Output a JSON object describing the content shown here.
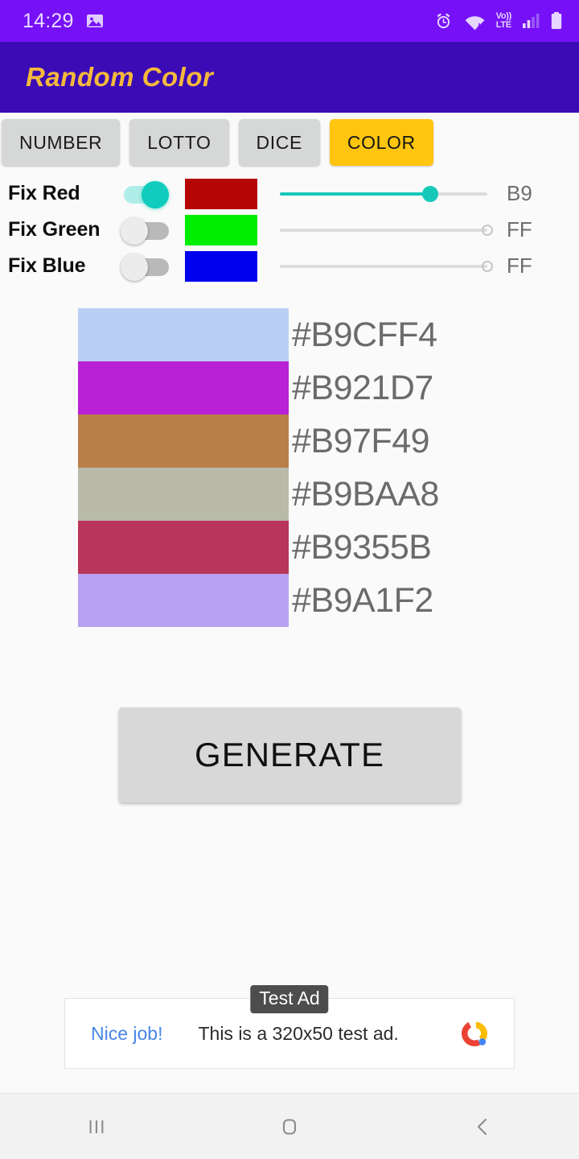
{
  "status_bar": {
    "time": "14:29",
    "icons": [
      "image-icon",
      "alarm-icon",
      "wifi-icon",
      "volte-icon",
      "signal-icon",
      "battery-icon"
    ],
    "volte_top": "Vo))",
    "volte_bottom": "LTE",
    "background": "#7510F7",
    "foreground": "#EADBFF"
  },
  "app_bar": {
    "title": "Random Color",
    "background": "#3B0CB5",
    "title_color": "#F5B93C"
  },
  "tabs": [
    {
      "label": "NUMBER",
      "selected": false
    },
    {
      "label": "LOTTO",
      "selected": false
    },
    {
      "label": "DICE",
      "selected": false
    },
    {
      "label": "COLOR",
      "selected": true
    }
  ],
  "tab_colors": {
    "normal_bg": "#D6D7D7",
    "selected_bg": "#FFC50F",
    "text": "#1A1A1A"
  },
  "fix_rows": [
    {
      "label": "Fix Red",
      "switch_on": true,
      "swatch": "#B50505",
      "slider_percent": 72.5,
      "hex": "B9"
    },
    {
      "label": "Fix Green",
      "switch_on": false,
      "swatch": "#00EE00",
      "slider_percent": 100,
      "hex": "FF"
    },
    {
      "label": "Fix Blue",
      "switch_on": false,
      "swatch": "#0000EE",
      "slider_percent": 100,
      "hex": "FF"
    }
  ],
  "switch_colors": {
    "on_thumb": "#11CCBC",
    "on_track": "#AFEDE8",
    "off_thumb": "#ECECEC",
    "off_track": "#B9B9B9"
  },
  "slider_colors": {
    "active": "#17C9B9",
    "track": "#DCDCDC"
  },
  "color_list": [
    {
      "hex": "#B9CFF4",
      "label": "#B9CFF4"
    },
    {
      "hex": "#B921D7",
      "label": "#B921D7"
    },
    {
      "hex": "#B97F49",
      "label": "#B97F49"
    },
    {
      "hex": "#B9BAA8",
      "label": "#B9BAA8"
    },
    {
      "hex": "#B9355B",
      "label": "#B9355B"
    },
    {
      "hex": "#B9A1F2",
      "label": "#B9A1F2"
    }
  ],
  "generate": {
    "label": "GENERATE",
    "background": "#D8D8D8",
    "text_color": "#111111"
  },
  "ad": {
    "badge": "Test Ad",
    "link_text": "Nice job!",
    "body_text": "This is a 320x50 test ad.",
    "link_color": "#4786E8",
    "logo": "admob-logo-icon"
  },
  "nav_bar": {
    "buttons": [
      "recents-icon",
      "home-icon",
      "back-icon"
    ],
    "background": "#F2F2F2"
  },
  "page_background": "#FAFAFA"
}
